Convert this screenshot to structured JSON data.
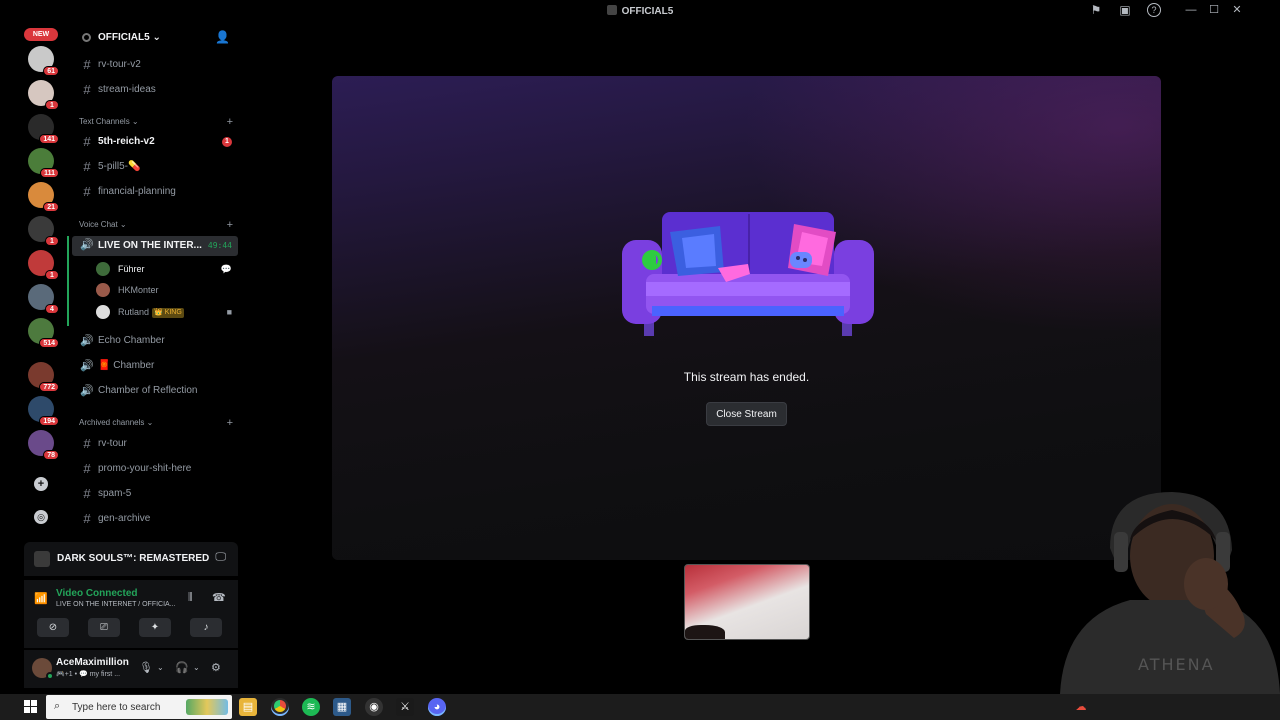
{
  "window": {
    "title": "OFFICIAL5"
  },
  "rail": {
    "new_label": "NEW",
    "servers": [
      {
        "badge": "61",
        "color": "#c9c9c9"
      },
      {
        "badge": "1",
        "color": "#d6c7c0"
      },
      {
        "badge": "141",
        "color": "#2a2a2a"
      },
      {
        "badge": "111",
        "color": "#4b7d3a"
      },
      {
        "badge": "21",
        "color": "#d98a3c"
      },
      {
        "badge": "1",
        "color": "#3a3a3a"
      },
      {
        "badge": "1",
        "color": "#c03a3a"
      },
      {
        "badge": "4",
        "color": "#5a6a7a"
      },
      {
        "badge": "514",
        "color": "#4d7a3e"
      },
      {
        "badge": "772",
        "color": "#7a3a2e"
      },
      {
        "badge": "194",
        "color": "#2e4a6a"
      },
      {
        "badge": "78",
        "color": "#6a4a8a"
      }
    ]
  },
  "guild": {
    "name": "OFFICIAL5"
  },
  "channels": {
    "top": [
      {
        "name": "rv-tour-v2"
      },
      {
        "name": "stream-ideas"
      }
    ],
    "text_category": "Text Channels",
    "text": [
      {
        "name": "5th-reich-v2",
        "unread": true,
        "mention": "1"
      },
      {
        "name": "5-pill5-💊",
        "unread": false
      },
      {
        "name": "financial-planning",
        "unread": false
      }
    ],
    "voice_category": "Voice Chat",
    "active_voice": {
      "name": "LIVE ON THE INTER...",
      "timer": "49:44"
    },
    "voice_users": [
      {
        "name": "Führer",
        "color": "#3e6b3a"
      },
      {
        "name": "HKMonter",
        "color": "#9a5a4a"
      },
      {
        "name": "Rutland",
        "tag": "👑 KING",
        "color": "#dddddd"
      }
    ],
    "voice": [
      {
        "name": "Echo Chamber"
      },
      {
        "name": "🧧 Chamber"
      },
      {
        "name": "Chamber of Reflection"
      }
    ],
    "archived_category": "Archived channels",
    "archived": [
      {
        "name": "rv-tour"
      },
      {
        "name": "promo-your-shit-here"
      },
      {
        "name": "spam-5"
      },
      {
        "name": "gen-archive"
      }
    ]
  },
  "activity": {
    "game": "DARK SOULS™: REMASTERED"
  },
  "voice_panel": {
    "status": "Video Connected",
    "channel": "LIVE ON THE INTERNET / OFFICIA..."
  },
  "user": {
    "name": "AceMaximillion",
    "status": "🎮+1 • 💬 my first ..."
  },
  "stage": {
    "message": "This stream has ended.",
    "close_button": "Close Stream"
  },
  "taskbar": {
    "search_placeholder": "Type here to search"
  },
  "colors": {
    "accent_green": "#23a55a",
    "mention_red": "#da373c",
    "stage_purple": "#2c1d54"
  }
}
